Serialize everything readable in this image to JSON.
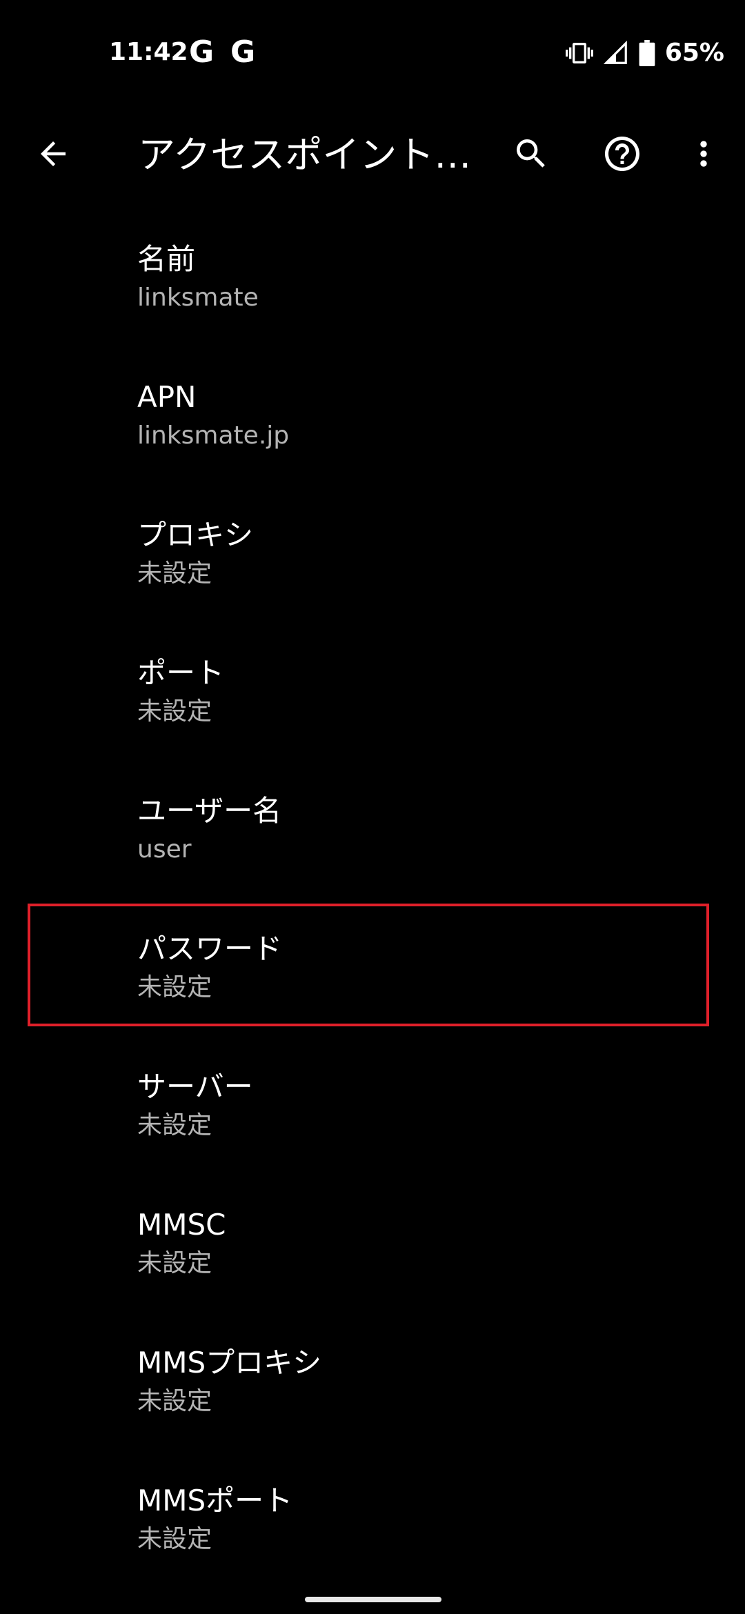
{
  "status_bar": {
    "time": "11:42",
    "notification_icons": [
      "G",
      "G"
    ],
    "battery_percent": "65%",
    "icons": [
      "vibrate-icon",
      "signal-icon",
      "battery-icon"
    ]
  },
  "app_bar": {
    "title": "アクセスポイント…",
    "icons": [
      "back-arrow-icon",
      "search-icon",
      "help-icon",
      "more-vert-icon"
    ]
  },
  "prefs": [
    {
      "title": "名前",
      "summary": "linksmate"
    },
    {
      "title": "APN",
      "summary": "linksmate.jp"
    },
    {
      "title": "プロキシ",
      "summary": "未設定"
    },
    {
      "title": "ポート",
      "summary": "未設定"
    },
    {
      "title": "ユーザー名",
      "summary": "user"
    },
    {
      "title": "パスワード",
      "summary": "未設定"
    },
    {
      "title": "サーバー",
      "summary": "未設定"
    },
    {
      "title": "MMSC",
      "summary": "未設定"
    },
    {
      "title": "MMSプロキシ",
      "summary": "未設定"
    },
    {
      "title": "MMSポート",
      "summary": "未設定"
    }
  ],
  "colors": {
    "background": "#000000",
    "text_primary": "#ffffff",
    "text_secondary": "#b4b4b4",
    "highlight": "#e0202a"
  }
}
